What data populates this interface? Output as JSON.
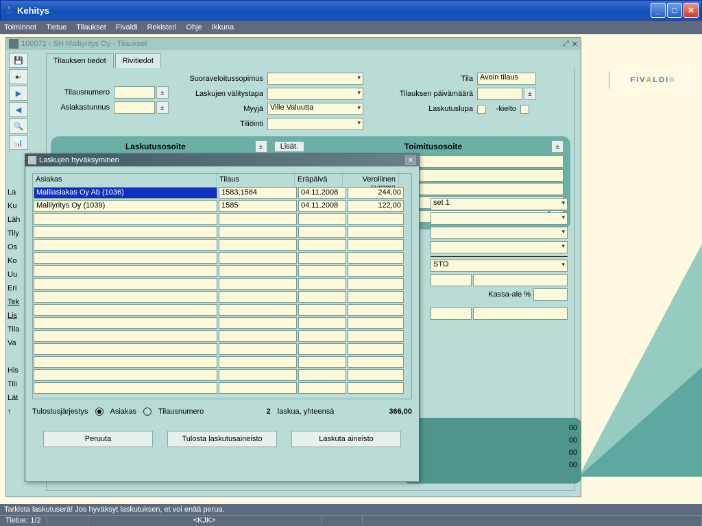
{
  "window": {
    "title": "Kehitys"
  },
  "menu": [
    "Toiminnot",
    "Tietue",
    "Tilaukset",
    "Fivaldi",
    "Rekisteri",
    "Ohje",
    "Ikkuna"
  ],
  "brand": "FIVALDI",
  "mdi": {
    "title": "100071 - SH Malliyritys Oy - Tilaukset",
    "tabs": [
      "Tilauksen tiedot",
      "Rivitiedot"
    ],
    "labels": {
      "tilausnumero": "Tilausnumero",
      "asiakastunnus": "Asiakastunnus",
      "suoraveloitussopimus": "Suoraveloitussopimus",
      "laskujen_valitystapa": "Laskujen välitystapa",
      "myyja": "Myyjä",
      "tiliointi": "Tiliöinti",
      "tila": "Tila",
      "tilauksen_pvm": "Tilauksen päivämäärä",
      "laskutuslupa": "Laskutuslupa",
      "kielto": "-kielto",
      "laskutusosoite": "Laskutusosoite",
      "toimitusosoite": "Toimitusosoite",
      "lisat": "Lisät.",
      "kassa_ale": "Kassa-ale %"
    },
    "values": {
      "myyja": "Ville Valuutta",
      "tila": "Avoin tilaus",
      "set1": "set 1",
      "sto": "STO"
    },
    "summary_suffix": "00",
    "left_partial": [
      "La",
      "Ku",
      "Läh",
      "Tily",
      "Os",
      "Ko",
      "Uu",
      "Eri",
      "Tek",
      "Lis",
      "Tila",
      "Va",
      "",
      "His",
      "Tili",
      "Lät",
      "↑"
    ]
  },
  "modal": {
    "title": "Laskujen hyväksyminen",
    "columns": [
      "Asiakas",
      "Tilaus",
      "Eräpäivä",
      "Verollinen summa"
    ],
    "rows": [
      {
        "asiakas": "Malliasiakas Oy Ab  (1036)",
        "tilaus": "1583,1584",
        "erapaiva": "04.11.2008",
        "summa": "244,00",
        "sel": true
      },
      {
        "asiakas": "Malliyritys Oy  (1039)",
        "tilaus": "1585",
        "erapaiva": "04.11.2008",
        "summa": "122,00",
        "sel": false
      }
    ],
    "sort_label": "Tulostusjärjestys",
    "radio1": "Asiakas",
    "radio2": "Tilausnumero",
    "count": "2",
    "count_suffix": "laskua, yhteensä",
    "total": "366,00",
    "buttons": [
      "Peruuta",
      "Tulosta laskutusaineisto",
      "Laskuta aineisto"
    ]
  },
  "status": {
    "msg": "Tarkista laskutuserä! Jos hyväksyt laskutuksen, et voi enää perua.",
    "record": "Tietue: 1/2",
    "user": "<KJK>"
  }
}
